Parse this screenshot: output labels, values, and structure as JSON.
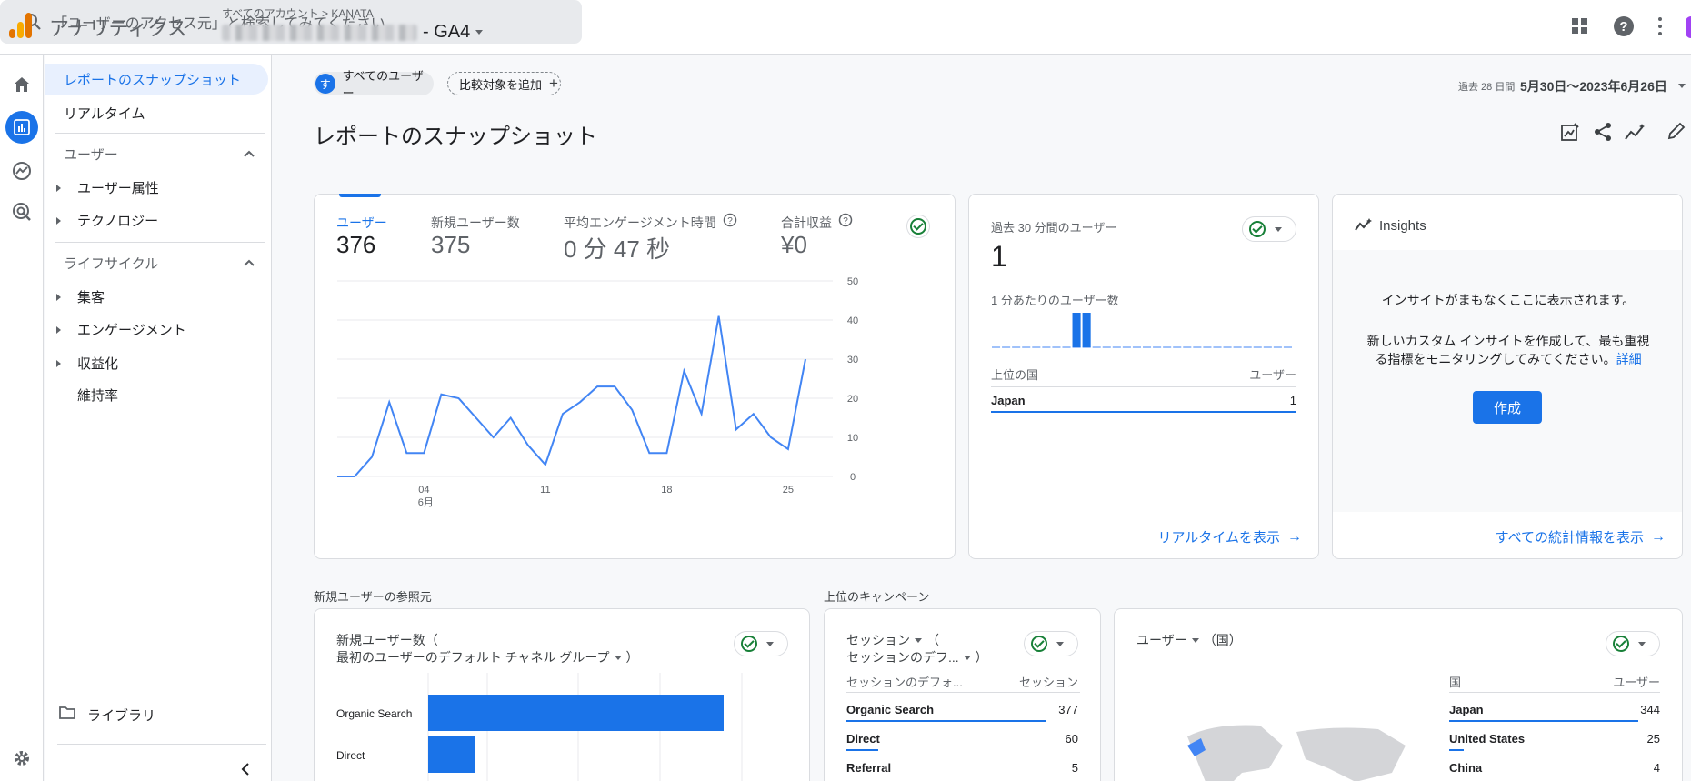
{
  "app": {
    "title": "アナリティクス",
    "breadcrumb": "すべてのアカウント",
    "account": "KANATA",
    "property": "- GA4"
  },
  "search": {
    "placeholder": "「ユーザーのアクセス元」と検索してみてください"
  },
  "sidenav": {
    "active": "レポートのスナップショット",
    "realtime": "リアルタイム",
    "user_section": "ユーザー",
    "user_items": [
      "ユーザー属性",
      "テクノロジー"
    ],
    "lifecycle_section": "ライフサイクル",
    "lifecycle_items": [
      "集客",
      "エンゲージメント",
      "収益化",
      "維持率"
    ],
    "library": "ライブラリ"
  },
  "filters": {
    "segment_badge": "す",
    "segment": "すべてのユーザー",
    "compare": "比較対象を追加"
  },
  "date": {
    "range_label": "過去 28 日間",
    "range": "5月30日～2023年6月26日"
  },
  "page_title": "レポートのスナップショット",
  "metrics": [
    {
      "label": "ユーザー",
      "value": "376"
    },
    {
      "label": "新規ユーザー数",
      "value": "375"
    },
    {
      "label": "平均エンゲージメント時間",
      "value": "0 分 47 秒"
    },
    {
      "label": "合計収益",
      "value": "¥0"
    }
  ],
  "chart_data": {
    "type": "line",
    "x_ticks": [
      "04",
      "11",
      "18",
      "25"
    ],
    "x_sublabel": "6月",
    "y_ticks": [
      "50",
      "40",
      "30",
      "20",
      "10",
      "0"
    ],
    "ylim": [
      0,
      50
    ],
    "series": [
      {
        "values": [
          0,
          0,
          5,
          19,
          6,
          6,
          21,
          20,
          15,
          10,
          15,
          8,
          3,
          16,
          19,
          23,
          23,
          17,
          6,
          6,
          27,
          16,
          41,
          12,
          16,
          10,
          7,
          30
        ]
      }
    ],
    "grid": true,
    "color": "#4285f4"
  },
  "realtime": {
    "title": "過去 30 分間のユーザー",
    "value": "1",
    "per_minute": "1 分あたりのユーザー数",
    "col_country": "上位の国",
    "col_users": "ユーザー",
    "row_country": "Japan",
    "row_value": "1",
    "link": "リアルタイムを表示"
  },
  "insights": {
    "title": "Insights",
    "line1": "インサイトがまもなくここに表示されます。",
    "line2": "新しいカスタム インサイトを作成して、最も重視",
    "line3": "る指標をモニタリングしてみてください。",
    "detail": "詳細",
    "create": "作成",
    "link": "すべての統計情報を表示"
  },
  "section_new_users": "新規ユーザーの参照元",
  "section_campaign": "上位のキャンペーン",
  "new_users_card": {
    "title1": "新規ユーザー数（",
    "title2": "最初のユーザーのデフォルト チャネル グループ",
    "title2_end": "）",
    "bars": [
      {
        "label": "Organic Search",
        "value": 344
      },
      {
        "label": "Direct",
        "value": 54
      }
    ]
  },
  "campaign_card": {
    "title1": "セッション",
    "title1_end": "（",
    "title2": "セッションのデフ...",
    "title2_end": "）",
    "col1": "セッションのデフォ...",
    "col2": "セッション",
    "rows": [
      {
        "name": "Organic Search",
        "value": "377"
      },
      {
        "name": "Direct",
        "value": "60"
      },
      {
        "name": "Referral",
        "value": "5"
      }
    ]
  },
  "country_card": {
    "title": "ユーザー",
    "title_end": "（国）",
    "col1": "国",
    "col2": "ユーザー",
    "rows": [
      {
        "name": "Japan",
        "value": "344"
      },
      {
        "name": "United States",
        "value": "25"
      },
      {
        "name": "China",
        "value": "4"
      }
    ]
  }
}
